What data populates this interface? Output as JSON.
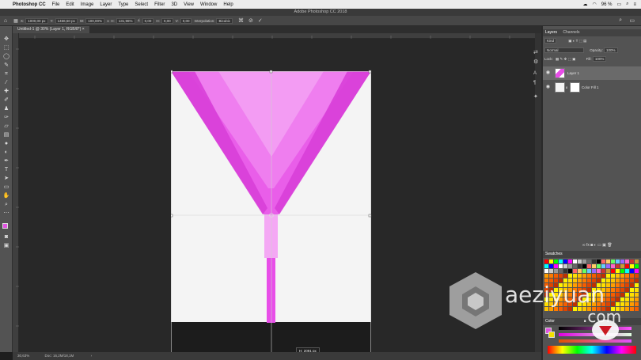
{
  "menubar": {
    "app_name": "Photoshop CC",
    "items": [
      "File",
      "Edit",
      "Image",
      "Layer",
      "Type",
      "Select",
      "Filter",
      "3D",
      "View",
      "Window",
      "Help"
    ],
    "battery": "96 %"
  },
  "window_title": "Adobe Photoshop CC 2018",
  "options_bar": {
    "x_value": "1000,00 px",
    "y_value": "1466,50 px",
    "w_value": "100,00%",
    "h_value": "131,96%",
    "angle": "0,00",
    "h_skew": "0,00",
    "v_skew": "0,00",
    "interpolation": "Bicubic"
  },
  "document_tab": "Untitled-1 @ 30% (Layer 1, RGB/8*) ×",
  "canvas": {
    "readout": "H: 2091 px"
  },
  "status": {
    "zoom": "30,63%",
    "doc_info": "Doc: 16,2M/18,1M"
  },
  "layers_panel": {
    "tabs": [
      "Layers",
      "Channels"
    ],
    "filter_kind": "Kind",
    "blend_mode": "Normal",
    "opacity_label": "Opacity:",
    "opacity_value": "100%",
    "lock_label": "Lock:",
    "fill_label": "Fill:",
    "fill_value": "100%",
    "layers": [
      {
        "name": "Layer 1",
        "selected": true
      },
      {
        "name": "Color Fill 1",
        "selected": false
      }
    ]
  },
  "swatches_panel": {
    "title": "Swatches"
  },
  "color_panel": {
    "title": "Color"
  },
  "watermark": {
    "text": "aeziyuan",
    "suffix": ".com"
  },
  "colors": {
    "magenta": "#e84ee8",
    "doc_bg": "#f4f4f4",
    "foreground": "#e052e0",
    "background": "#f5e000"
  }
}
